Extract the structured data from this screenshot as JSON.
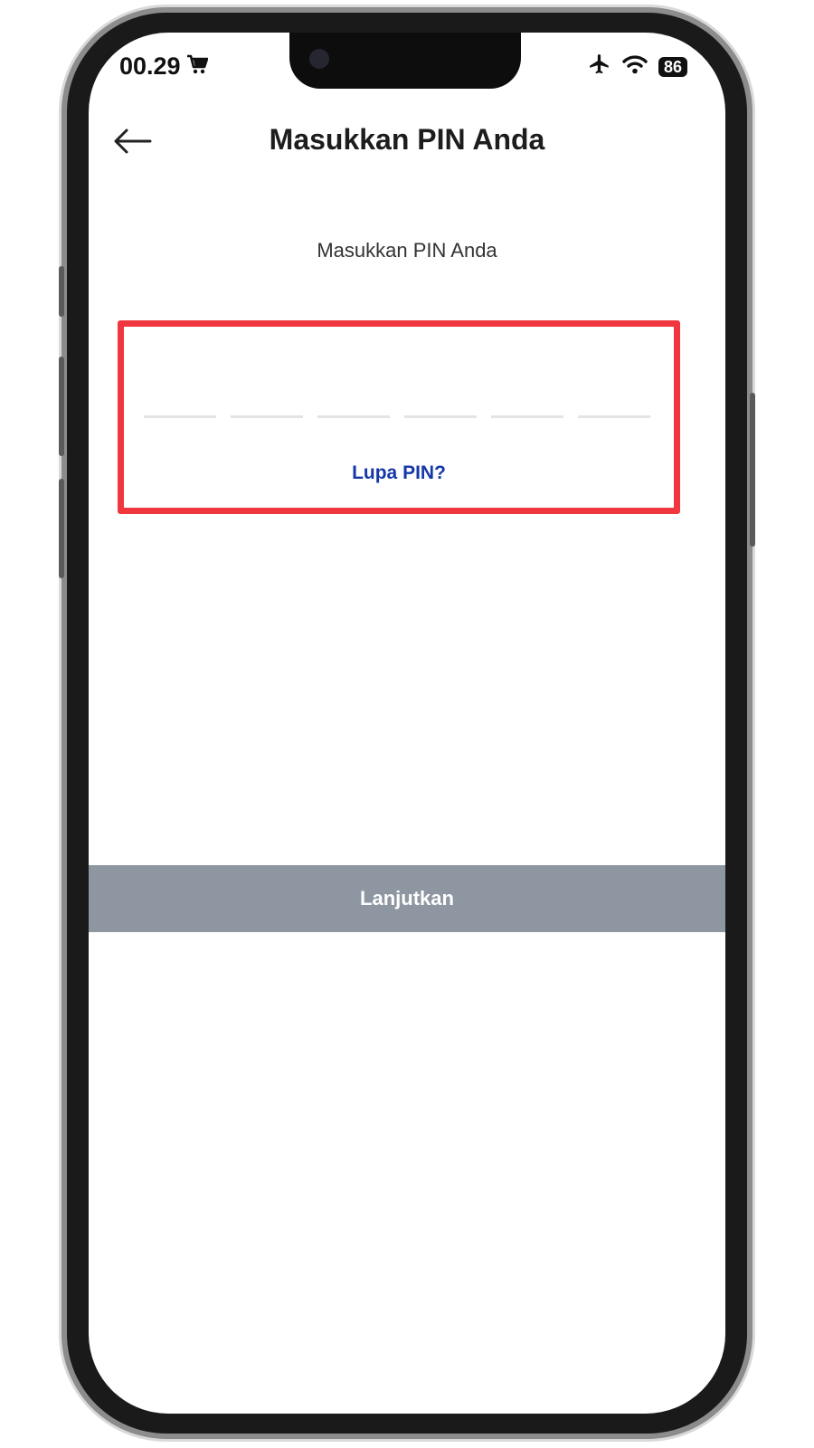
{
  "status_bar": {
    "time": "00.29",
    "battery": "86"
  },
  "header": {
    "title": "Masukkan PIN Anda"
  },
  "pin": {
    "prompt": "Masukkan PIN Anda",
    "forgot_label": "Lupa PIN?",
    "digits": 6
  },
  "actions": {
    "continue_label": "Lanjutkan"
  },
  "colors": {
    "highlight": "#f0363f",
    "link": "#1537a8",
    "button_disabled": "#8d96a1"
  },
  "icons": {
    "back": "arrow-left-icon",
    "cart": "cart-icon",
    "airplane": "airplane-icon",
    "wifi": "wifi-icon"
  }
}
